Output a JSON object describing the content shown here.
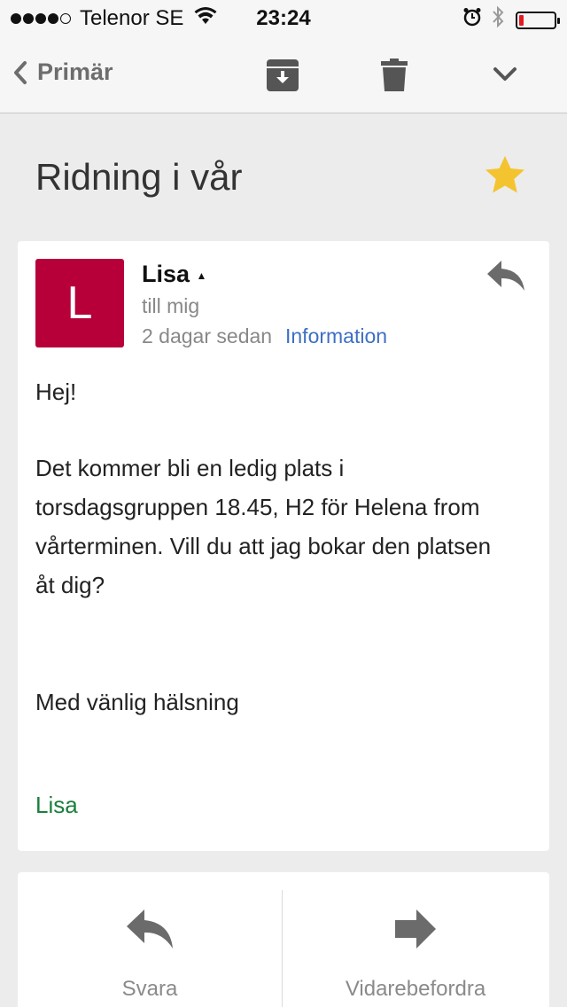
{
  "status_bar": {
    "carrier": "Telenor SE",
    "time": "23:24",
    "signal_bars_filled": 4,
    "battery_level": 0.12,
    "icons": [
      "signal-icon",
      "wifi-icon",
      "alarm-icon",
      "bluetooth-icon",
      "battery-icon"
    ]
  },
  "nav": {
    "back_label": "Primär",
    "icons": [
      "chevron-left-icon",
      "archive-icon",
      "trash-icon",
      "chevron-down-icon"
    ]
  },
  "email": {
    "subject": "Ridning i vår",
    "starred": true,
    "sender_initial": "L",
    "sender_name": "Lisa",
    "recipient": "till mig",
    "date": "2 dagar sedan",
    "info_link": "Information",
    "body": {
      "greeting": "Hej!",
      "line1": "Det kommer bli en ledig plats i",
      "line2": "torsdagsgruppen 18.45, H2 för Helena from",
      "line3": "vårterminen. Vill du att jag bokar den platsen",
      "line4": "åt dig?",
      "closing": "Med vänlig hälsning",
      "signature": "Lisa"
    }
  },
  "actions": {
    "reply_label": "Svara",
    "forward_label": "Vidarebefordra"
  },
  "colors": {
    "avatar": "#b7003a",
    "link": "#3d6fc4",
    "signature": "#1a7f3c",
    "star": "#f4c430",
    "battery_low": "#e31b23"
  }
}
